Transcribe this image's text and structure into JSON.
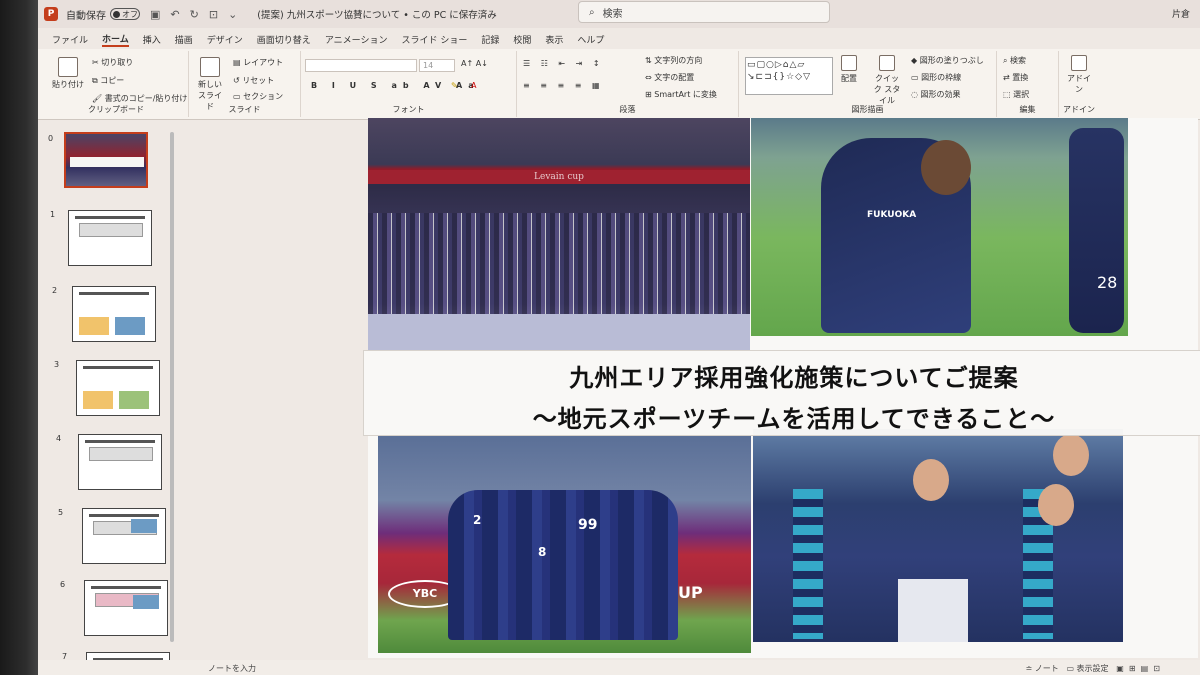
{
  "titlebar": {
    "autosave_label": "自動保存",
    "autosave_state": "オフ",
    "document_title": "(提案) 九州スポーツ協賛について • この PC に保存済み",
    "search_placeholder": "検索",
    "user_name": "片倉"
  },
  "menu_tabs": [
    "ファイル",
    "ホーム",
    "挿入",
    "描画",
    "デザイン",
    "画面切り替え",
    "アニメーション",
    "スライド ショー",
    "記録",
    "校閲",
    "表示",
    "ヘルプ"
  ],
  "ribbon": {
    "clipboard": {
      "paste": "貼り付け",
      "cut": "切り取り",
      "copy": "コピー",
      "format_painter": "書式のコピー/貼り付け",
      "label": "クリップボード"
    },
    "slides": {
      "new_slide": "新しい スライド",
      "layout": "レイアウト",
      "reset": "リセット",
      "section": "セクション",
      "label": "スライド"
    },
    "font": {
      "size": "14",
      "label": "フォント"
    },
    "paragraph": {
      "text_direction": "文字列の方向",
      "align_text": "文字の配置",
      "smartart": "SmartArt に変換",
      "label": "段落"
    },
    "drawing": {
      "arrange": "配置",
      "quick_styles": "クイック スタイル",
      "shape_fill": "図形の塗りつぶし",
      "shape_outline": "図形の枠線",
      "shape_effects": "図形の効果",
      "label": "図形描画"
    },
    "editing": {
      "find": "検索",
      "replace": "置換",
      "select": "選択",
      "label": "編集"
    },
    "addins": {
      "addins": "アドイン",
      "label": "アドイン"
    }
  },
  "thumbnails": [
    {
      "num": "0",
      "selected": true
    },
    {
      "num": "1",
      "selected": false
    },
    {
      "num": "2",
      "selected": false
    },
    {
      "num": "3",
      "selected": false
    },
    {
      "num": "4",
      "selected": false
    },
    {
      "num": "5",
      "selected": false
    },
    {
      "num": "6",
      "selected": false
    },
    {
      "num": "7",
      "selected": false
    }
  ],
  "slide": {
    "title_line1": "九州エリア採用強化施策についてご提案",
    "title_line2": "〜地元スポーツチームを活用してできること〜",
    "photo_texts": {
      "banner": "Levain cup",
      "sponsor": "FUKUOKA",
      "jersey_28": "28",
      "ybc": "YBC",
      "up": "UP",
      "jersey_2": "2",
      "jersey_99": "99",
      "jersey_8": "8"
    }
  },
  "statusbar": {
    "notes_placeholder": "ノートを入力",
    "notes_button": "ノート",
    "display_settings": "表示設定"
  },
  "colors": {
    "accent": "#c43e1c"
  }
}
